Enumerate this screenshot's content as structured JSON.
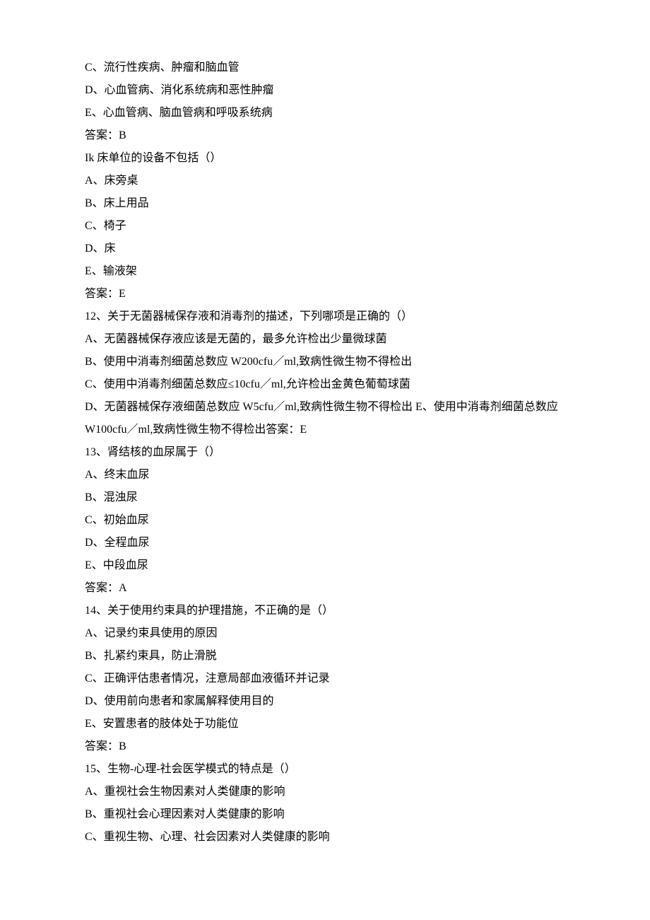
{
  "q10_options": {
    "c": "C、流行性疾病、肿瘤和脑血管",
    "d": "D、心血管病、消化系统病和恶性肿瘤",
    "e": "E、心血管病、脑血管病和呼吸系统病"
  },
  "q10_answer": "答案：B",
  "q11": {
    "stem": "Ik 床单位的设备不包括（）",
    "a": "A、床旁桌",
    "b": "B、床上用品",
    "c": "C、椅子",
    "d": "D、床",
    "e": "E、输液架",
    "answer": "答案：E"
  },
  "q12": {
    "stem": "12、关于无菌器械保存液和消毒剂的描述，下列哪项是正确的（）",
    "a": "A、无菌器械保存液应该是无菌的，最多允许检出少量微球菌",
    "b": "B、使用中消毒剂细菌总数应 W200cfu／ml,致病性微生物不得检出",
    "c": "C、使用中消毒剂细菌总数应≤10cfu／ml,允许检出金黄色葡萄球菌",
    "d_e_answer": "D、无菌器械保存液细菌总数应 W5cfu／ml,致病性微生物不得检出 E、使用中消毒剂细菌总数应 W100cfu／ml,致病性微生物不得检出答案：E"
  },
  "q13": {
    "stem": "13、肾结核的血尿属于（）",
    "a": "A、终末血尿",
    "b": "B、混浊尿",
    "c": "C、初始血尿",
    "d": "D、全程血尿",
    "e": "E、中段血尿",
    "answer": "答案：A"
  },
  "q14": {
    "stem": "14、关于使用约束具的护理措施，不正确的是（）",
    "a": "A、记录约束具使用的原因",
    "b": "B、扎紧约束具，防止滑脱",
    "c": "C、正确评估患者情况，注意局部血液循环并记录",
    "d": "D、使用前向患者和家属解释使用目的",
    "e": "E、安置患者的肢体处于功能位",
    "answer": "答案：B"
  },
  "q15": {
    "stem": "15、生物-心理-社会医学模式的特点是（）",
    "a": "A、重视社会生物因素对人类健康的影响",
    "b": "B、重视社会心理因素对人类健康的影响",
    "c": "C、重视生物、心理、社会因素对人类健康的影响"
  }
}
